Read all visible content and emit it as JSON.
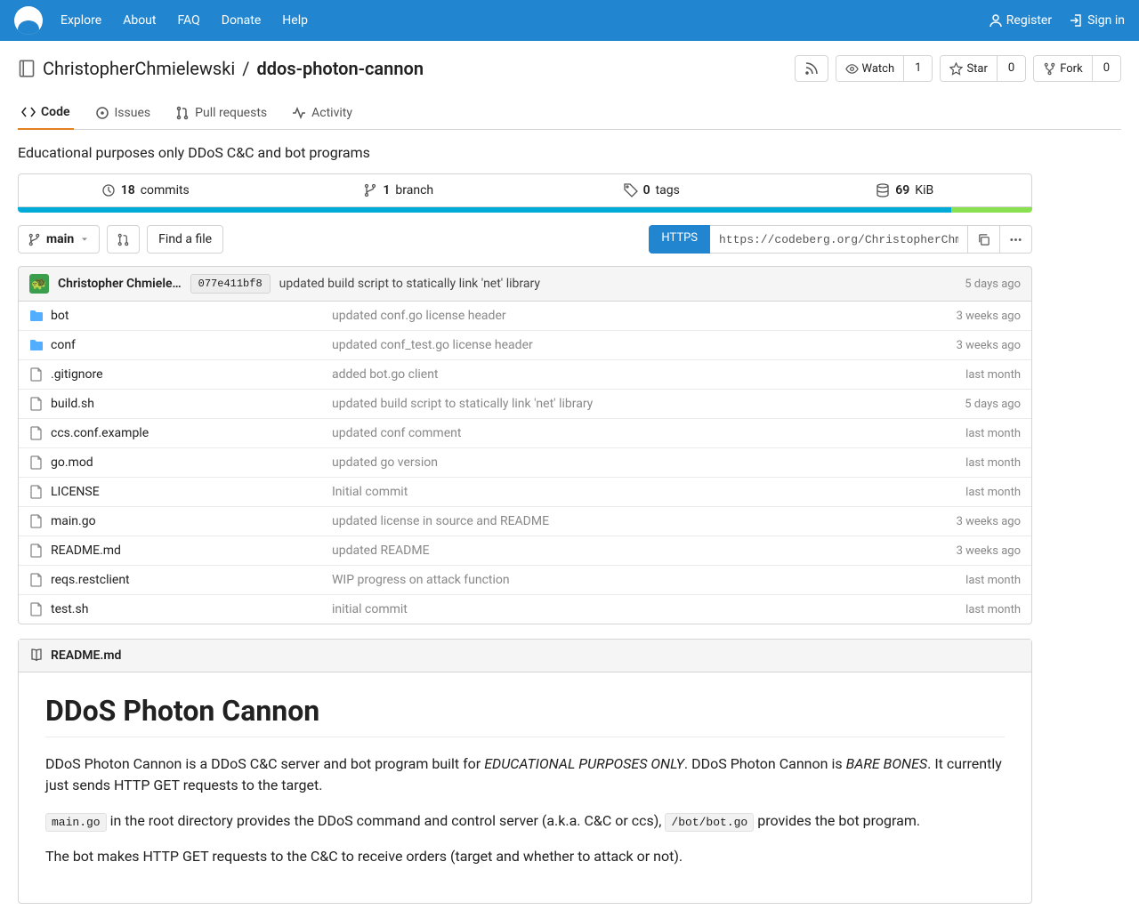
{
  "nav": {
    "explore": "Explore",
    "about": "About",
    "faq": "FAQ",
    "donate": "Donate",
    "help": "Help",
    "register": "Register",
    "signin": "Sign in"
  },
  "repo": {
    "owner": "ChristopherChmielewski",
    "slash": "/",
    "name": "ddos-photon-cannon",
    "watch": "Watch",
    "watch_count": "1",
    "star": "Star",
    "star_count": "0",
    "fork": "Fork",
    "fork_count": "0"
  },
  "tabs": {
    "code": "Code",
    "issues": "Issues",
    "pulls": "Pull requests",
    "activity": "Activity"
  },
  "description": "Educational purposes only DDoS C&C and bot programs",
  "stats": {
    "commits_n": "18",
    "commits": "commits",
    "branches_n": "1",
    "branches": "branch",
    "tags_n": "0",
    "tags": "tags",
    "size_n": "69",
    "size": "KiB"
  },
  "toolbar": {
    "branch": "main",
    "find_file": "Find a file",
    "https": "HTTPS",
    "clone_url": "https://codeberg.org/ChristopherChmielewski/ddos-photon-cannon.git"
  },
  "last_commit": {
    "author": "Christopher Chmiele…",
    "sha": "077e411bf8",
    "message": "updated build script to statically link 'net' library",
    "time": "5 days ago"
  },
  "files": [
    {
      "type": "folder",
      "name": "bot",
      "msg": "updated conf.go license header",
      "time": "3 weeks ago"
    },
    {
      "type": "folder",
      "name": "conf",
      "msg": "updated conf_test.go license header",
      "time": "3 weeks ago"
    },
    {
      "type": "file",
      "name": ".gitignore",
      "msg": "added bot.go client",
      "time": "last month"
    },
    {
      "type": "file",
      "name": "build.sh",
      "msg": "updated build script to statically link 'net' library",
      "time": "5 days ago"
    },
    {
      "type": "file",
      "name": "ccs.conf.example",
      "msg": "updated conf comment",
      "time": "last month"
    },
    {
      "type": "file",
      "name": "go.mod",
      "msg": "updated go version",
      "time": "last month"
    },
    {
      "type": "file",
      "name": "LICENSE",
      "msg": "Initial commit",
      "time": "last month"
    },
    {
      "type": "file",
      "name": "main.go",
      "msg": "updated license in source and README",
      "time": "3 weeks ago"
    },
    {
      "type": "file",
      "name": "README.md",
      "msg": "updated README",
      "time": "3 weeks ago"
    },
    {
      "type": "file",
      "name": "reqs.restclient",
      "msg": "WIP progress on attack function",
      "time": "last month"
    },
    {
      "type": "file",
      "name": "test.sh",
      "msg": "initial commit",
      "time": "last month"
    }
  ],
  "readme": {
    "filename": "README.md",
    "h1": "DDoS Photon Cannon",
    "p1_a": "DDoS Photon Cannon is a DDoS C&C server and bot program built for ",
    "p1_em1": "EDUCATIONAL PURPOSES ONLY",
    "p1_b": ". DDoS Photon Cannon is ",
    "p1_em2": "BARE BONES",
    "p1_c": ". It currently just sends HTTP GET requests to the target.",
    "p2_code1": "main.go",
    "p2_a": " in the root directory provides the DDoS command and control server (a.k.a. C&C or ccs), ",
    "p2_code2": "/bot/bot.go",
    "p2_b": " provides the bot program.",
    "p3": "The bot makes HTTP GET requests to the C&C to receive orders (target and whether to attack or not)."
  }
}
